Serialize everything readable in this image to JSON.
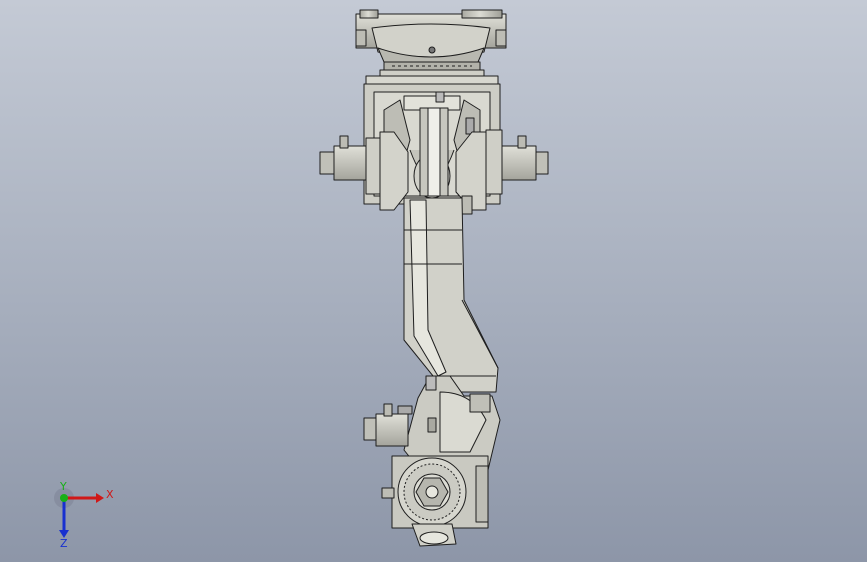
{
  "viewport": {
    "background_top": "#c4cad5",
    "background_bottom": "#8d96a8"
  },
  "model": {
    "part_color": "#c9c9c0",
    "edge_color": "#1e1e1e",
    "shade_color": "#9a9a92",
    "highlight_color": "#e6e6de"
  },
  "triad": {
    "x_label": "X",
    "y_label": "Y",
    "z_label": "Z",
    "x_color": "#d01818",
    "y_color": "#18b018",
    "z_color": "#1830d0"
  }
}
